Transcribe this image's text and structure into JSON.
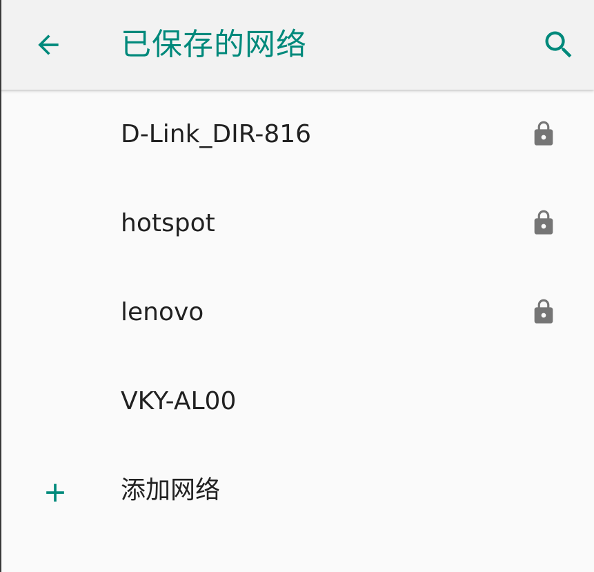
{
  "header": {
    "title": "已保存的网络",
    "back_icon": "arrow-left-icon",
    "search_icon": "search-icon"
  },
  "networks": [
    {
      "ssid": "D-Link_DIR-816",
      "secured": true
    },
    {
      "ssid": "hotspot",
      "secured": true
    },
    {
      "ssid": "lenovo",
      "secured": true
    },
    {
      "ssid": "VKY-AL00",
      "secured": false
    }
  ],
  "add_network": {
    "label": "添加网络",
    "icon": "plus-icon"
  },
  "colors": {
    "accent": "#00897b",
    "lock": "#757575",
    "text": "#212121",
    "appbar": "#f2f2f2",
    "background": "#fafafa"
  }
}
